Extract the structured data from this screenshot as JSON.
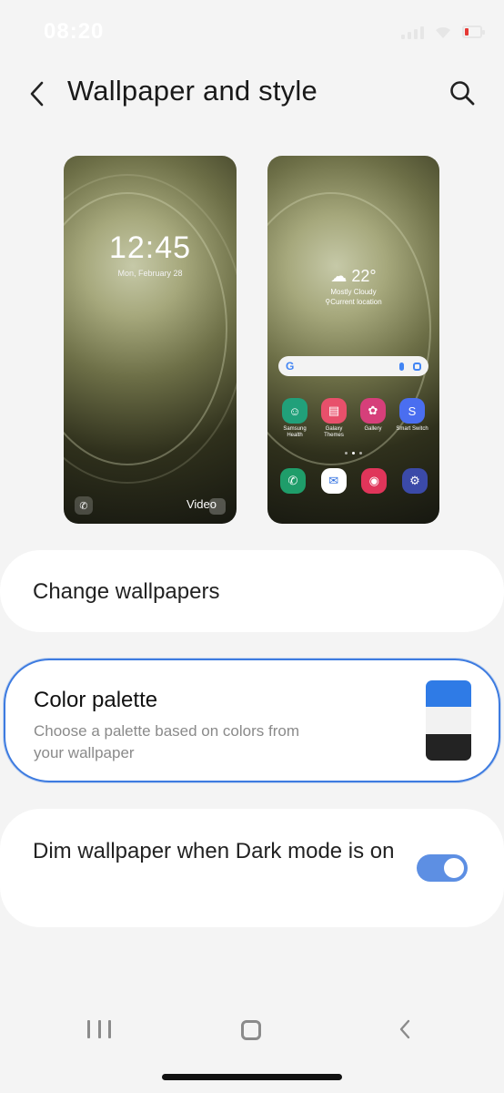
{
  "status_bar": {
    "time": "08:20"
  },
  "header": {
    "title": "Wallpaper and style"
  },
  "previews": {
    "lock": {
      "time": "12:45",
      "date": "Mon, February 28",
      "video_label": "Video"
    },
    "home": {
      "weather": {
        "temp": "22°",
        "condition": "Mostly Cloudy",
        "location": "Current location"
      },
      "search_letter": "G",
      "apps": [
        {
          "label": "Samsung Health",
          "color": "#21a07a",
          "glyph": "☺"
        },
        {
          "label": "Galaxy Themes",
          "color": "#e8506b",
          "glyph": "▤"
        },
        {
          "label": "Gallery",
          "color": "#d63f7a",
          "glyph": "✿"
        },
        {
          "label": "Smart Switch",
          "color": "#4a6ef0",
          "glyph": "S"
        }
      ],
      "dock": [
        {
          "name": "phone",
          "color": "#1f9d6a",
          "glyph": "✆"
        },
        {
          "name": "messages",
          "color": "#ffffff",
          "glyph": "✉"
        },
        {
          "name": "camera",
          "color": "#e0355a",
          "glyph": "◉"
        },
        {
          "name": "settings",
          "color": "#3b4aa8",
          "glyph": "⚙"
        }
      ]
    }
  },
  "change_wallpapers": {
    "label": "Change wallpapers"
  },
  "color_palette": {
    "title": "Color palette",
    "description": "Choose a palette based on colors from your wallpaper",
    "swatch_colors": [
      "#2f7be6",
      "#f2f2f2",
      "#232323"
    ]
  },
  "dim_wallpaper": {
    "label": "Dim wallpaper when Dark mode is on",
    "enabled": true
  },
  "colors": {
    "accent": "#3d7be0",
    "toggle_on": "#5d8fe3",
    "background": "#f4f4f4"
  }
}
